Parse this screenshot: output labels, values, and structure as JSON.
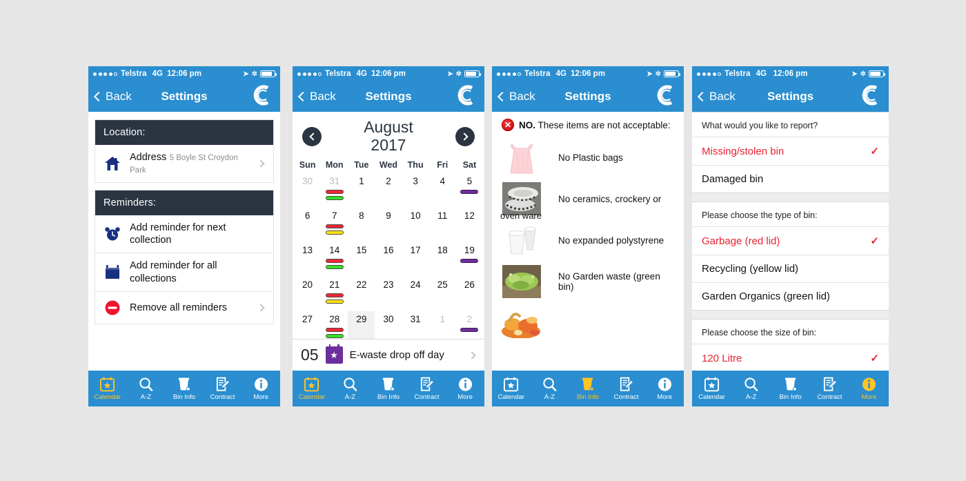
{
  "colors": {
    "page_background": "#e6e6e6",
    "brand_blue": "#2a8ed0",
    "dark_navy": "#2b3542",
    "accent_yellow": "#ffc425",
    "alert_red": "#e8222e",
    "bin_red": "#f42534",
    "bin_green": "#34e024",
    "bin_yellow": "#ffe500",
    "bin_purple": "#6d2f9c"
  },
  "status_bar": {
    "signal_dots_filled": 4,
    "signal_dots_total": 5,
    "carrier": "Telstra",
    "network": "4G",
    "time": "12:06 pm",
    "location_icon": "location-arrow-icon",
    "bluetooth_icon": "bluetooth-icon",
    "battery_icon": "battery-icon"
  },
  "nav": {
    "back_label": "Back",
    "title": "Settings",
    "logo": "council-c-logo"
  },
  "tabs": [
    {
      "label": "Calendar",
      "icon": "calendar-star-icon"
    },
    {
      "label": "A-Z",
      "icon": "search-icon"
    },
    {
      "label": "Bin Info",
      "icon": "bin-icon"
    },
    {
      "label": "Contract",
      "icon": "form-pencil-icon"
    },
    {
      "label": "More",
      "icon": "info-icon"
    }
  ],
  "screen1": {
    "active_tab": "Calendar",
    "sections": [
      {
        "heading": "Location:",
        "rows": [
          {
            "icon": "home-icon",
            "title": "Address",
            "subtitle": "5 Boyle St Croydon Park",
            "chevron": true
          }
        ]
      },
      {
        "heading": "Reminders:",
        "rows": [
          {
            "icon": "alarm-clock-icon",
            "title": "Add reminder for next collection",
            "subtitle": "",
            "chevron": false
          },
          {
            "icon": "calendar-icon",
            "title": "Add reminder for all collections",
            "subtitle": "",
            "chevron": false
          },
          {
            "icon": "remove-circle-icon",
            "title": "Remove all reminders",
            "subtitle": "",
            "chevron": true
          }
        ]
      }
    ]
  },
  "screen2": {
    "active_tab": "Calendar",
    "prev_label": "previous-month",
    "next_label": "next-month",
    "month": "August",
    "year": "2017",
    "day_headers": [
      "Sun",
      "Mon",
      "Tue",
      "Wed",
      "Thu",
      "Fri",
      "Sat"
    ],
    "weeks": [
      [
        {
          "num": "30",
          "out": true,
          "bars": []
        },
        {
          "num": "31",
          "out": true,
          "bars": [
            "red",
            "green"
          ]
        },
        {
          "num": "1",
          "out": false,
          "bars": []
        },
        {
          "num": "2",
          "out": false,
          "bars": []
        },
        {
          "num": "3",
          "out": false,
          "bars": []
        },
        {
          "num": "4",
          "out": false,
          "bars": []
        },
        {
          "num": "5",
          "out": false,
          "bars": [
            "purple"
          ]
        }
      ],
      [
        {
          "num": "6",
          "out": false,
          "bars": []
        },
        {
          "num": "7",
          "out": false,
          "bars": [
            "red",
            "yellow"
          ]
        },
        {
          "num": "8",
          "out": false,
          "bars": []
        },
        {
          "num": "9",
          "out": false,
          "bars": []
        },
        {
          "num": "10",
          "out": false,
          "bars": []
        },
        {
          "num": "11",
          "out": false,
          "bars": []
        },
        {
          "num": "12",
          "out": false,
          "bars": []
        }
      ],
      [
        {
          "num": "13",
          "out": false,
          "bars": []
        },
        {
          "num": "14",
          "out": false,
          "bars": [
            "red",
            "green"
          ]
        },
        {
          "num": "15",
          "out": false,
          "bars": []
        },
        {
          "num": "16",
          "out": false,
          "bars": []
        },
        {
          "num": "17",
          "out": false,
          "bars": []
        },
        {
          "num": "18",
          "out": false,
          "bars": []
        },
        {
          "num": "19",
          "out": false,
          "bars": [
            "purple"
          ]
        }
      ],
      [
        {
          "num": "20",
          "out": false,
          "bars": []
        },
        {
          "num": "21",
          "out": false,
          "bars": [
            "red",
            "yellow"
          ]
        },
        {
          "num": "22",
          "out": false,
          "bars": []
        },
        {
          "num": "23",
          "out": false,
          "bars": []
        },
        {
          "num": "24",
          "out": false,
          "bars": []
        },
        {
          "num": "25",
          "out": false,
          "bars": []
        },
        {
          "num": "26",
          "out": false,
          "bars": []
        }
      ],
      [
        {
          "num": "27",
          "out": false,
          "bars": []
        },
        {
          "num": "28",
          "out": false,
          "bars": [
            "red",
            "green"
          ]
        },
        {
          "num": "29",
          "out": false,
          "selected": true,
          "bars": []
        },
        {
          "num": "30",
          "out": false,
          "bars": []
        },
        {
          "num": "31",
          "out": false,
          "bars": []
        },
        {
          "num": "1",
          "out": true,
          "bars": []
        },
        {
          "num": "2",
          "out": true,
          "bars": [
            "purple"
          ]
        }
      ]
    ],
    "event": {
      "day": "05",
      "icon": "calendar-star-purple-icon",
      "label": "E-waste drop off day",
      "chevron": true
    }
  },
  "screen3": {
    "active_tab": "Bin Info",
    "header": {
      "badge": "no-x-icon",
      "strong": "NO.",
      "text": " These items are not acceptable:"
    },
    "items": [
      {
        "thumb": "plastic-bag-photo",
        "label": "No Plastic bags",
        "caption": ""
      },
      {
        "thumb": "oven-ware-photo",
        "label": "No ceramics, crockery or",
        "caption": "oven ware"
      },
      {
        "thumb": "polystyrene-cups-photo",
        "label": "No expanded polystyrene",
        "caption": ""
      },
      {
        "thumb": "garden-waste-photo",
        "label": "No Garden waste (green bin)",
        "caption": ""
      },
      {
        "thumb": "food-scraps-photo",
        "label": "",
        "caption": ""
      }
    ]
  },
  "screen4": {
    "active_tab": "More",
    "groups": [
      {
        "label": "What would you like to report?",
        "options": [
          {
            "text": "Missing/stolen bin",
            "selected": true
          },
          {
            "text": "Damaged bin",
            "selected": false
          }
        ]
      },
      {
        "label": "Please choose the type of bin:",
        "options": [
          {
            "text": "Garbage (red lid)",
            "selected": true
          },
          {
            "text": "Recycling (yellow lid)",
            "selected": false
          },
          {
            "text": "Garden Organics (green lid)",
            "selected": false
          }
        ]
      },
      {
        "label": "Please choose the size of bin:",
        "options": [
          {
            "text": "120 Litre",
            "selected": true
          }
        ]
      }
    ],
    "check_glyph": "✓"
  }
}
